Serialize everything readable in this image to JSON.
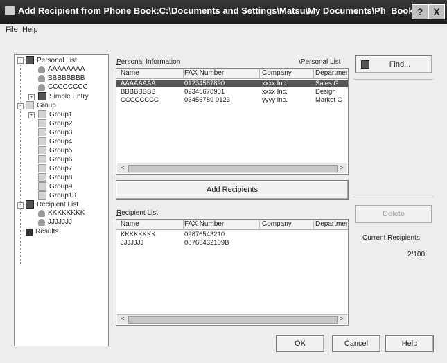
{
  "window": {
    "title": "Add Recipient from Phone Book:C:\\Documents and Settings\\Matsu\\My Documents\\Ph_Book.csv",
    "help_glyph": "?",
    "close_glyph": "X"
  },
  "menu": {
    "file": "File",
    "help": "Help"
  },
  "tree": {
    "personal_list": "Personal List",
    "entries": [
      "AAAAAAAA",
      "BBBBBBBB",
      "CCCCCCCC"
    ],
    "simple_entry": "Simple Entry",
    "group": "Group",
    "groups": [
      "Group1",
      "Group2",
      "Group3",
      "Group4",
      "Group5",
      "Group6",
      "Group7",
      "Group8",
      "Group9",
      "Group10"
    ],
    "recipient_list": "Recipient List",
    "recipients": [
      "KKKKKKKK",
      "JJJJJJJ"
    ],
    "results": "Results"
  },
  "personal": {
    "label": "Personal Information",
    "path": "\\Personal List",
    "columns": [
      "Name",
      "FAX Number",
      "Company",
      "Department"
    ],
    "rows": [
      [
        "AAAAAAAA",
        "01234567890",
        "xxxx Inc.",
        "Sales G"
      ],
      [
        "BBBBBBBB",
        "02345678901",
        "xxxx Inc.",
        "Design"
      ],
      [
        "CCCCCCCC",
        "03456789 0123",
        "yyyy Inc.",
        "Market G"
      ]
    ]
  },
  "add_recipients": "Add Recipients",
  "recipient": {
    "label": "Recipient List",
    "columns": [
      "Name",
      "FAX Number",
      "Company",
      "Department"
    ],
    "rows": [
      [
        "KKKKKKKK",
        "09876543210",
        "",
        ""
      ],
      [
        "JJJJJJJ",
        "08765432109B",
        "",
        ""
      ]
    ]
  },
  "right": {
    "find": "Find...",
    "delete": "Delete",
    "current_recipients_label": "Current Recipients",
    "current_recipients_value": "2/100"
  },
  "buttons": {
    "ok": "OK",
    "cancel": "Cancel",
    "help": "Help"
  },
  "scroll": {
    "left": "<",
    "right": ">"
  }
}
